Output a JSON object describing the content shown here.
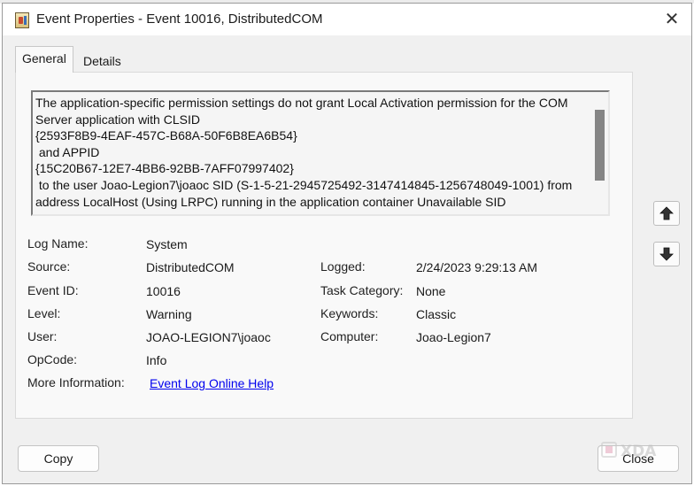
{
  "window": {
    "title": "Event Properties - Event 10016, DistributedCOM",
    "close_glyph": "✕"
  },
  "tabs": [
    {
      "label": "General",
      "active": true
    },
    {
      "label": "Details",
      "active": false
    }
  ],
  "description": "The application-specific permission settings do not grant Local Activation permission for the COM Server application with CLSID\n{2593F8B9-4EAF-457C-B68A-50F6B8EA6B54}\n and APPID\n{15C20B67-12E7-4BB6-92BB-7AFF07997402}\n to the user Joao-Legion7\\joaoc SID (S-1-5-21-2945725492-3147414845-1256748049-1001) from address LocalHost (Using LRPC) running in the application container Unavailable SID",
  "fields": {
    "log_name": {
      "label": "Log Name:",
      "value": "System"
    },
    "source": {
      "label": "Source:",
      "value": "DistributedCOM"
    },
    "logged": {
      "label": "Logged:",
      "value": "2/24/2023 9:29:13 AM"
    },
    "event_id": {
      "label": "Event ID:",
      "value": "10016"
    },
    "task_category": {
      "label": "Task Category:",
      "value": "None"
    },
    "level": {
      "label": "Level:",
      "value": "Warning"
    },
    "keywords": {
      "label": "Keywords:",
      "value": "Classic"
    },
    "user": {
      "label": "User:",
      "value": "JOAO-LEGION7\\joaoc"
    },
    "computer": {
      "label": "Computer:",
      "value": "Joao-Legion7"
    },
    "opcode": {
      "label": "OpCode:",
      "value": "Info"
    },
    "more_info": {
      "label": "More Information:",
      "link": "Event Log Online Help"
    }
  },
  "buttons": {
    "copy": "Copy",
    "close": "Close"
  },
  "watermark": "XDA",
  "icons": {
    "up": "arrow-up-icon",
    "down": "arrow-down-icon"
  },
  "colors": {
    "link": "#0000ee",
    "window_bg": "#f0f0f0",
    "panel_bg": "#f9f9f9"
  }
}
